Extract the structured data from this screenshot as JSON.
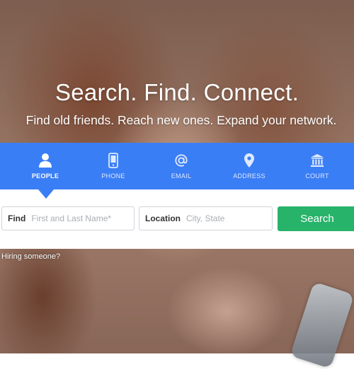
{
  "hero": {
    "title": "Search. Find. Connect.",
    "subtitle": "Find old friends. Reach new ones. Expand your network."
  },
  "tabs": [
    {
      "label": "PEOPLE",
      "icon": "person-icon",
      "active": true
    },
    {
      "label": "PHONE",
      "icon": "phone-icon",
      "active": false
    },
    {
      "label": "EMAIL",
      "icon": "at-icon",
      "active": false
    },
    {
      "label": "ADDRESS",
      "icon": "map-pin-icon",
      "active": false
    },
    {
      "label": "COURT",
      "icon": "courthouse-icon",
      "active": false
    }
  ],
  "search": {
    "find_label": "Find",
    "find_placeholder": "First and Last Name*",
    "location_label": "Location",
    "location_placeholder": "City, State",
    "button_label": "Search"
  },
  "footer": {
    "hiring_link": "Hiring someone?"
  },
  "colors": {
    "tab_bar": "#3a7ef6",
    "search_button": "#27b36a",
    "search_panel": "#ffffff"
  }
}
